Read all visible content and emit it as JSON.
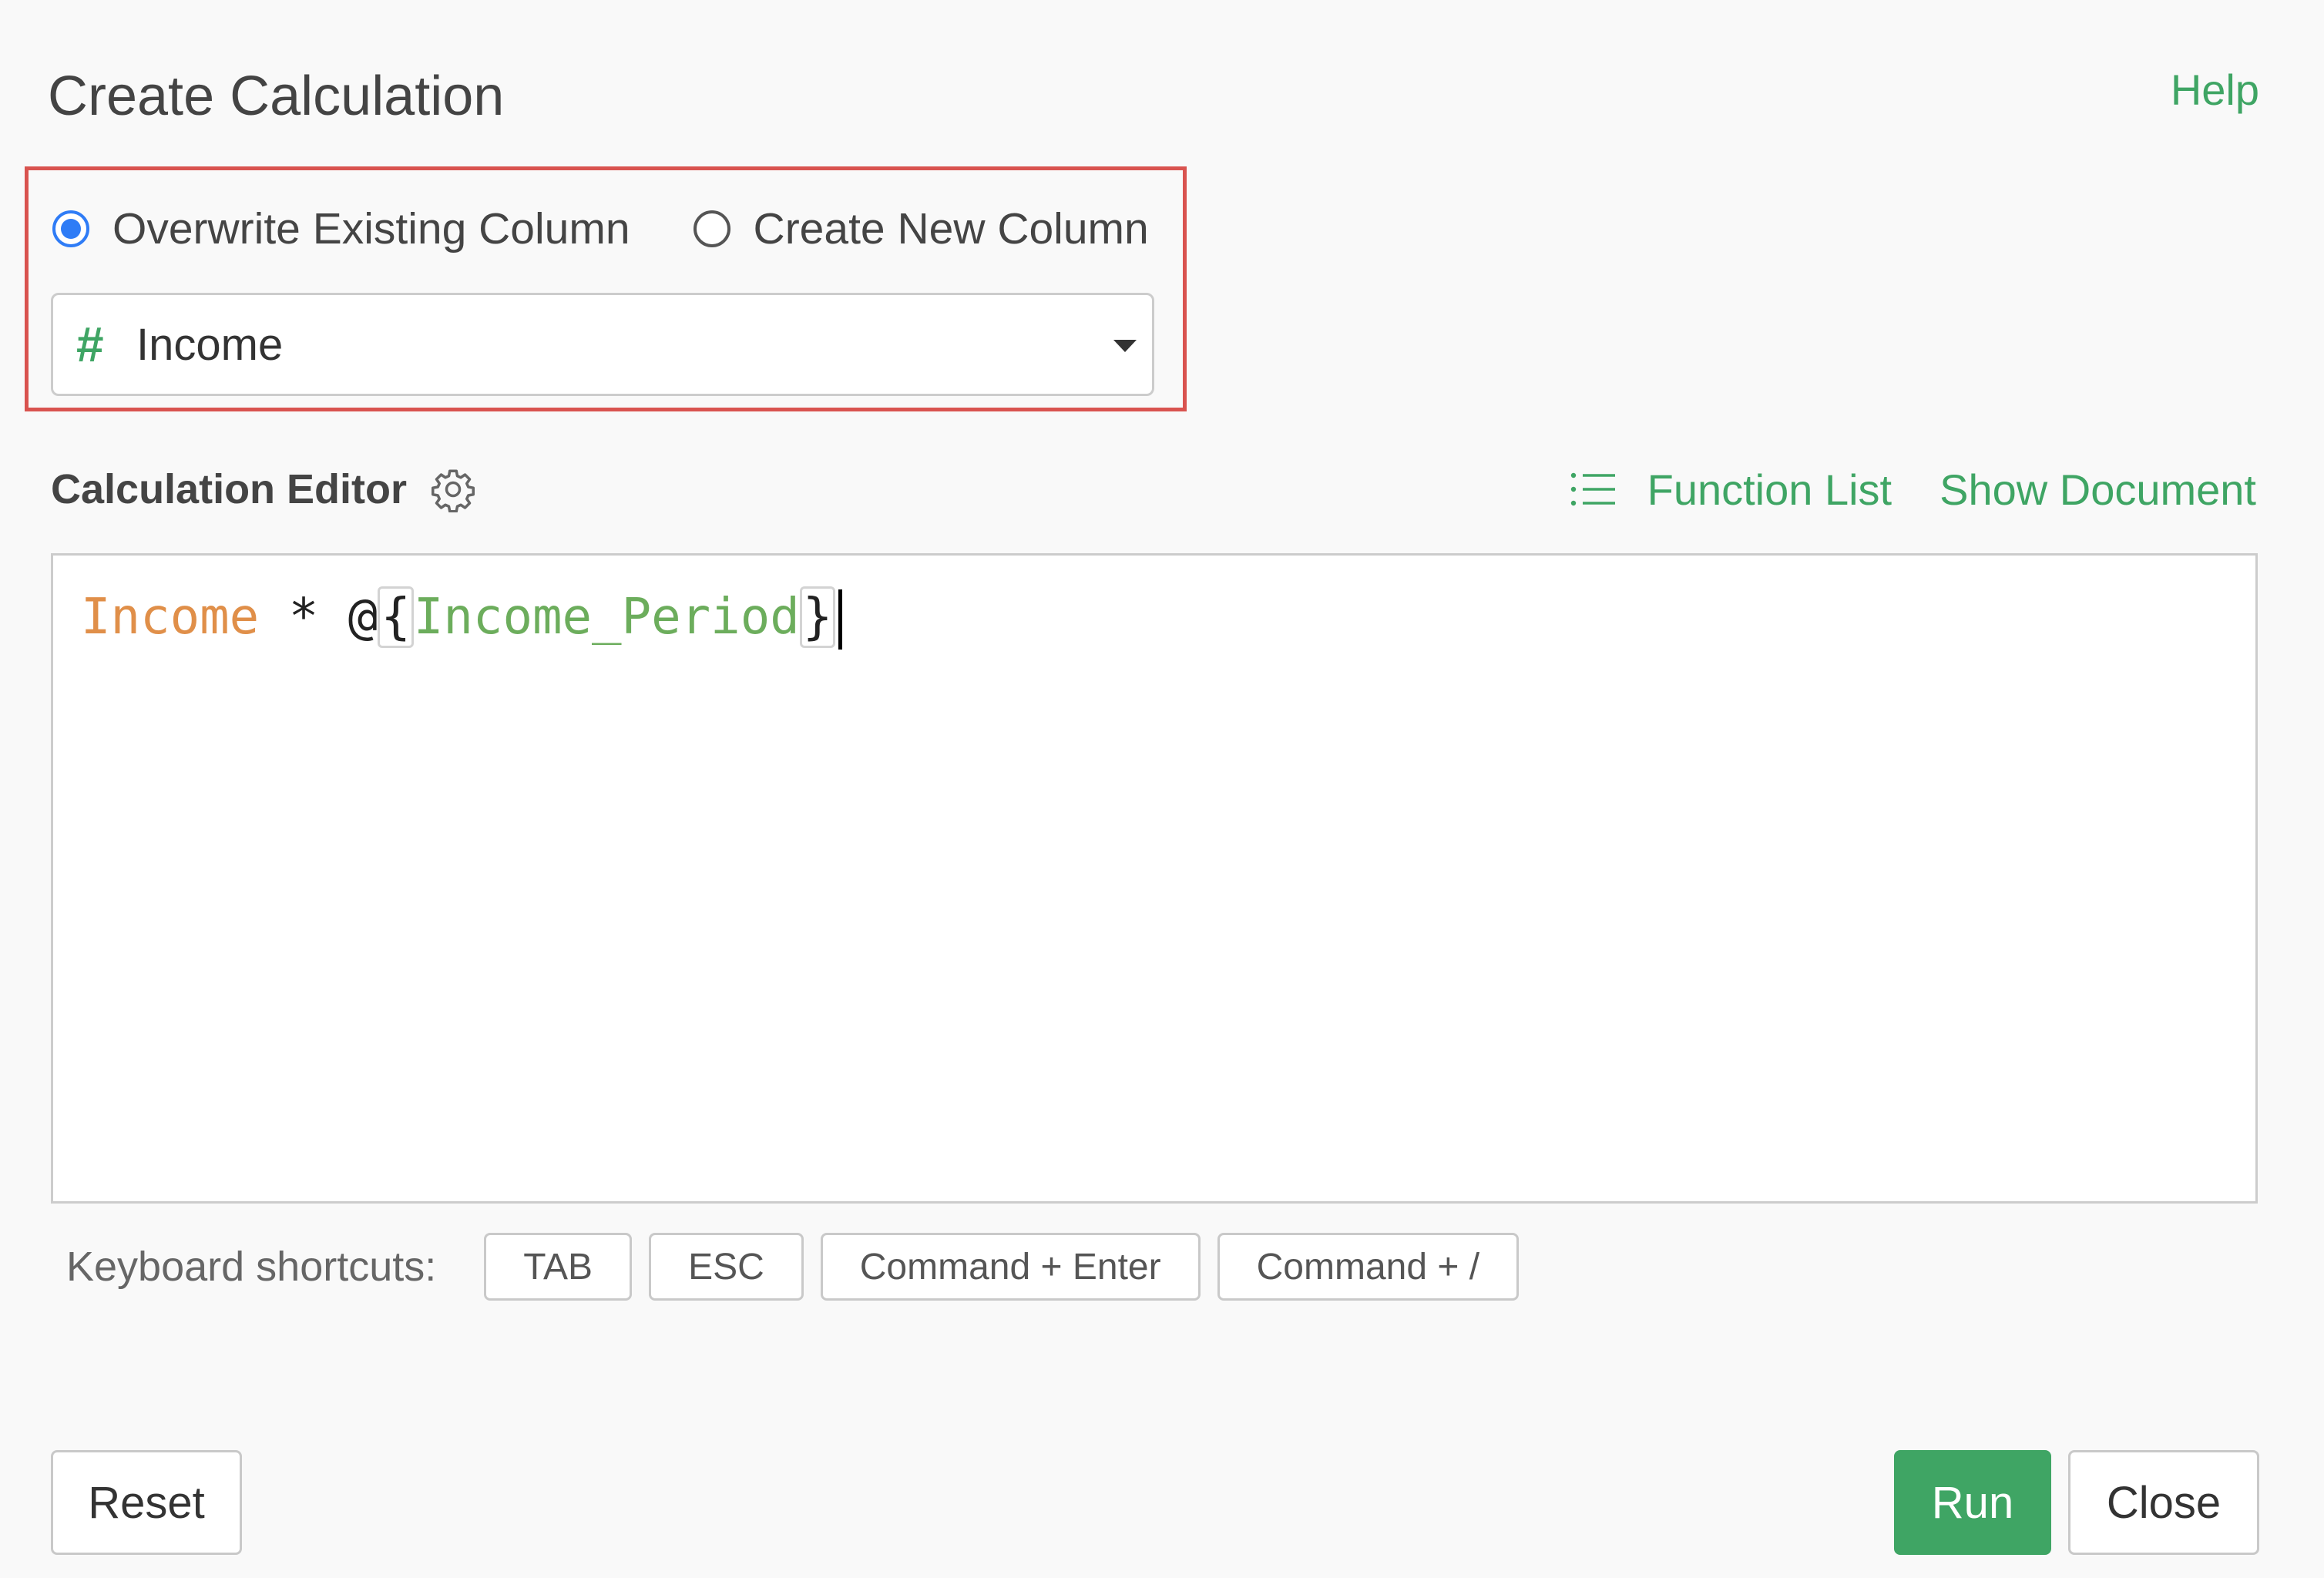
{
  "dialog": {
    "title": "Create Calculation",
    "help_label": "Help"
  },
  "target": {
    "options": [
      {
        "label": "Overwrite Existing Column",
        "selected": true
      },
      {
        "label": "Create New Column",
        "selected": false
      }
    ],
    "column_select": {
      "type_icon": "number-hash-icon",
      "type_symbol": "#",
      "value": "Income"
    }
  },
  "editor": {
    "label": "Calculation Editor",
    "settings_icon": "gear-icon",
    "function_list_label": "Function List",
    "function_list_icon": "list-icon",
    "show_document_label": "Show Document",
    "code": {
      "column": "Income",
      "operator": " * ",
      "at": "@",
      "open_brace": "{",
      "parameter": "Income_Period",
      "close_brace": "}"
    }
  },
  "shortcuts": {
    "label": "Keyboard shortcuts:",
    "keys": [
      "TAB",
      "ESC",
      "Command + Enter",
      "Command + /"
    ]
  },
  "footer": {
    "reset_label": "Reset",
    "run_label": "Run",
    "close_label": "Close"
  },
  "colors": {
    "accent_green": "#3fa564",
    "radio_blue": "#2f7cf6",
    "highlight_red": "#d9534f",
    "column_token": "#e08f49",
    "parameter_token": "#6cad5c"
  }
}
